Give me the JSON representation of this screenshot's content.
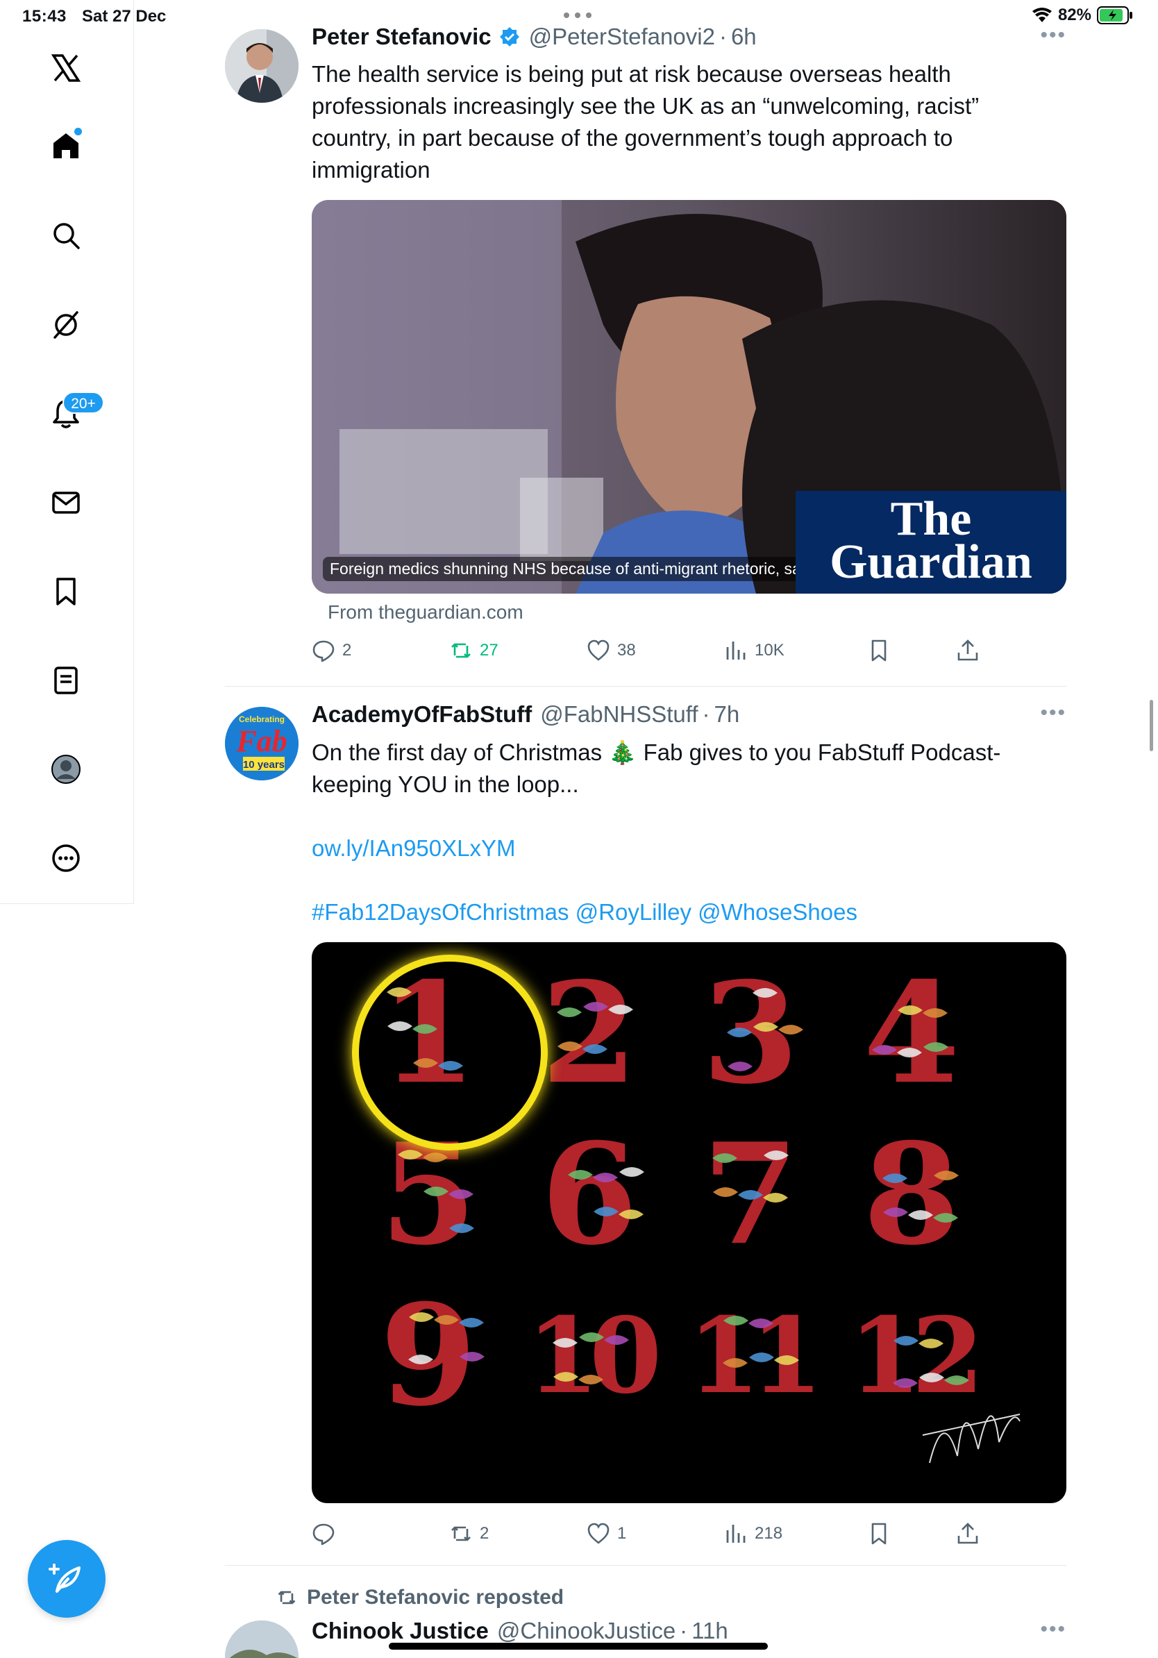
{
  "status_bar": {
    "time": "15:43",
    "date": "Sat 27 Dec",
    "battery": "82%"
  },
  "sidebar": {
    "items": [
      {
        "name": "x-logo-icon"
      },
      {
        "name": "home-icon"
      },
      {
        "name": "search-icon"
      },
      {
        "name": "grok-icon"
      },
      {
        "name": "notifications-icon"
      },
      {
        "name": "messages-icon"
      },
      {
        "name": "bookmarks-icon"
      },
      {
        "name": "lists-icon"
      },
      {
        "name": "profile-icon"
      },
      {
        "name": "more-icon"
      }
    ],
    "notification_badge": "20+"
  },
  "tweets": [
    {
      "display_name": "Peter Stefanovic",
      "handle": "@PeterStefanovi2",
      "time": "6h",
      "text": "The health service is being put at risk because overseas health professionals increasingly see the UK as an “unwelcoming, racist” country, in part because of the government’s tough approach to immigration",
      "card": {
        "caption": "Foreign medics shunning NHS because of anti-migrant rhetoric, says top doctor",
        "logo_line1": "The",
        "logo_line2": "Guardian",
        "source": "From theguardian.com"
      },
      "replies": "2",
      "reposts": "27",
      "likes": "38",
      "views": "10K"
    },
    {
      "display_name": "AcademyOfFabStuff",
      "handle": "@FabNHSStuff",
      "time": "7h",
      "avatar_text_top": "Celebrating",
      "avatar_text_main": "Fab",
      "avatar_text_bottom": "10 years",
      "text": "On the first day of Christmas 🎄 Fab gives to you FabStuff Podcast- keeping YOU in the loop...",
      "link": "ow.ly/IAn950XLxYM",
      "hashtags": "#Fab12DaysOfChristmas @RoyLilley @WhoseShoes",
      "image_numbers": [
        "1",
        "2",
        "3",
        "4",
        "5",
        "6",
        "7",
        "8",
        "9",
        "10",
        "11",
        "12"
      ],
      "replies": "",
      "reposts": "2",
      "likes": "1",
      "views": "218"
    },
    {
      "repost_label": "Peter Stefanovic reposted",
      "display_name": "Chinook Justice",
      "handle": "@ChinookJustice",
      "time": "11h"
    }
  ],
  "colors": {
    "accent": "#1d9bf0",
    "retweet_green": "#00ba7c",
    "muted": "#536471",
    "guardian_blue": "#052962"
  }
}
